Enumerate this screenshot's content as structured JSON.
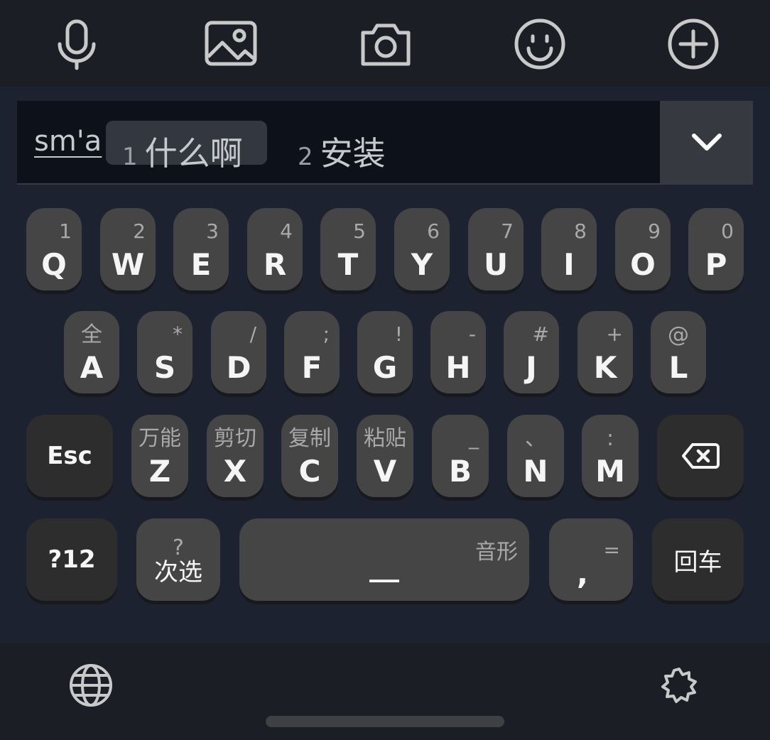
{
  "toolbar": {
    "icons": [
      "microphone-icon",
      "image-icon",
      "camera-icon",
      "emoji-icon",
      "plus-icon"
    ]
  },
  "candidates": {
    "pinyin": "sm'a",
    "items": [
      {
        "num": "1",
        "word": "什么啊"
      },
      {
        "num": "2",
        "word": "安装"
      }
    ],
    "expand_icon": "chevron-down-icon"
  },
  "keyboard": {
    "row1": [
      {
        "main": "Q",
        "sub": "1"
      },
      {
        "main": "W",
        "sub": "2"
      },
      {
        "main": "E",
        "sub": "3"
      },
      {
        "main": "R",
        "sub": "4"
      },
      {
        "main": "T",
        "sub": "5"
      },
      {
        "main": "Y",
        "sub": "6"
      },
      {
        "main": "U",
        "sub": "7"
      },
      {
        "main": "I",
        "sub": "8"
      },
      {
        "main": "O",
        "sub": "9"
      },
      {
        "main": "P",
        "sub": "0"
      }
    ],
    "row2": [
      {
        "main": "A",
        "sub": "全"
      },
      {
        "main": "S",
        "sub": "*"
      },
      {
        "main": "D",
        "sub": "/"
      },
      {
        "main": "F",
        "sub": ";"
      },
      {
        "main": "G",
        "sub": "!"
      },
      {
        "main": "H",
        "sub": "-"
      },
      {
        "main": "J",
        "sub": "#"
      },
      {
        "main": "K",
        "sub": "+"
      },
      {
        "main": "L",
        "sub": "@"
      }
    ],
    "row3": [
      {
        "main": "Z",
        "sub": "万能"
      },
      {
        "main": "X",
        "sub": "剪切"
      },
      {
        "main": "C",
        "sub": "复制"
      },
      {
        "main": "V",
        "sub": "粘贴"
      },
      {
        "main": "B",
        "sub": "_"
      },
      {
        "main": "N",
        "sub": "、"
      },
      {
        "main": "M",
        "sub": ":"
      }
    ],
    "esc": "Esc",
    "backspace_icon": "backspace-icon",
    "symbols": "?12",
    "next_select": {
      "main": "次选",
      "sub": "?"
    },
    "space": {
      "main": "__",
      "sub": "音形"
    },
    "comma": {
      "main": ",",
      "sub": "="
    },
    "enter": "回车"
  },
  "bottombar": {
    "left_icon": "globe-icon",
    "right_icon": "settings-gear-icon"
  }
}
